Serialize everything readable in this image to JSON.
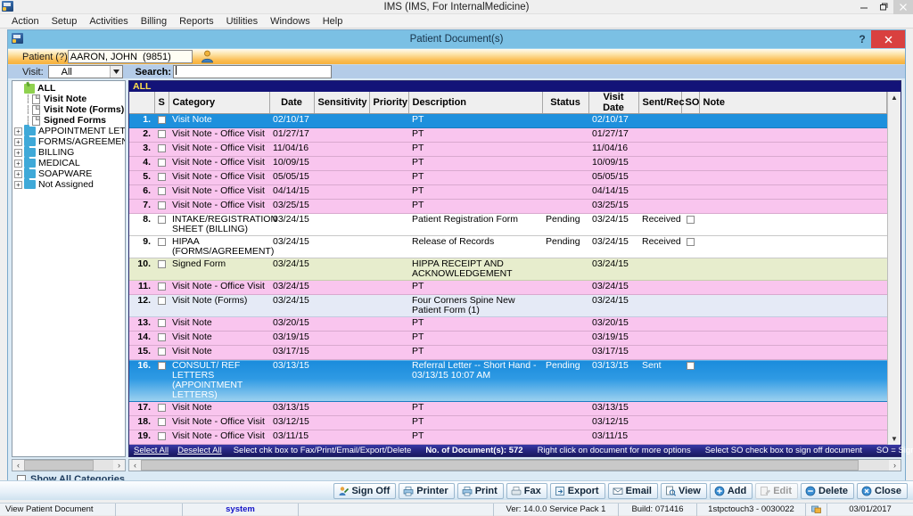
{
  "window": {
    "title": "IMS (IMS, For InternalMedicine)",
    "minimize": "–",
    "restore": "❐",
    "close": "✕"
  },
  "menubar": {
    "items": [
      "Action",
      "Setup",
      "Activities",
      "Billing",
      "Reports",
      "Utilities",
      "Windows",
      "Help"
    ]
  },
  "child_window": {
    "title": "Patient Document(s)",
    "help_label": "?",
    "close_label": "✕"
  },
  "patient_bar": {
    "label": "Patient (?)",
    "value": "AARON, JOHN  (9851)",
    "placeholder": ""
  },
  "search_bar": {
    "visit_label": "Visit:",
    "visit_value": "All",
    "search_label": "Search:",
    "search_value": "",
    "search_placeholder": ""
  },
  "tree": {
    "root": "ALL",
    "items": [
      {
        "label": "Visit Note",
        "icon": "document-icon",
        "bold": true,
        "expandable": false
      },
      {
        "label": "Visit Note (Forms)",
        "icon": "document-icon",
        "bold": true,
        "expandable": false
      },
      {
        "label": "Signed Forms",
        "icon": "document-icon",
        "bold": true,
        "expandable": false
      },
      {
        "label": "APPOINTMENT LETTER",
        "icon": "folder-icon",
        "bold": false,
        "expandable": true
      },
      {
        "label": "FORMS/AGREEMENT",
        "icon": "folder-icon",
        "bold": false,
        "expandable": true
      },
      {
        "label": "BILLING",
        "icon": "folder-icon",
        "bold": false,
        "expandable": true
      },
      {
        "label": "MEDICAL",
        "icon": "folder-icon",
        "bold": false,
        "expandable": true
      },
      {
        "label": "SOAPWARE",
        "icon": "folder-icon",
        "bold": false,
        "expandable": true
      },
      {
        "label": "Not Assigned",
        "icon": "folder-icon",
        "bold": false,
        "expandable": true
      }
    ]
  },
  "grid": {
    "tab_label": "ALL",
    "columns": [
      "",
      "S",
      "Category",
      "Date",
      "Sensitivity",
      "Priority",
      "Description",
      "Status",
      "Visit Date",
      "Sent/Rec",
      "SO",
      "Note"
    ],
    "rows": [
      {
        "n": "1.",
        "category": "Visit Note",
        "date": "02/10/17",
        "sensitivity": "",
        "priority": "",
        "description": "PT",
        "status": "",
        "visit_date": "02/10/17",
        "sent_rec": "",
        "so": "",
        "note": "",
        "style": "sel"
      },
      {
        "n": "2.",
        "category": "Visit Note - Office Visit",
        "date": "01/27/17",
        "sensitivity": "",
        "priority": "",
        "description": "PT",
        "status": "",
        "visit_date": "01/27/17",
        "sent_rec": "",
        "so": "",
        "note": "",
        "style": "pink"
      },
      {
        "n": "3.",
        "category": "Visit Note - Office Visit",
        "date": "11/04/16",
        "sensitivity": "",
        "priority": "",
        "description": "PT",
        "status": "",
        "visit_date": "11/04/16",
        "sent_rec": "",
        "so": "",
        "note": "",
        "style": "pink"
      },
      {
        "n": "4.",
        "category": "Visit Note - Office Visit",
        "date": "10/09/15",
        "sensitivity": "",
        "priority": "",
        "description": "PT",
        "status": "",
        "visit_date": "10/09/15",
        "sent_rec": "",
        "so": "",
        "note": "",
        "style": "pink"
      },
      {
        "n": "5.",
        "category": "Visit Note - Office Visit",
        "date": "05/05/15",
        "sensitivity": "",
        "priority": "",
        "description": "PT",
        "status": "",
        "visit_date": "05/05/15",
        "sent_rec": "",
        "so": "",
        "note": "",
        "style": "pink"
      },
      {
        "n": "6.",
        "category": "Visit Note - Office Visit",
        "date": "04/14/15",
        "sensitivity": "",
        "priority": "",
        "description": "PT",
        "status": "",
        "visit_date": "04/14/15",
        "sent_rec": "",
        "so": "",
        "note": "",
        "style": "pink"
      },
      {
        "n": "7.",
        "category": "Visit Note - Office Visit",
        "date": "03/25/15",
        "sensitivity": "",
        "priority": "",
        "description": "PT",
        "status": "",
        "visit_date": "03/25/15",
        "sent_rec": "",
        "so": "",
        "note": "",
        "style": "pink"
      },
      {
        "n": "8.",
        "category": "INTAKE/REGISTRATION SHEET (BILLING)",
        "date": "03/24/15",
        "sensitivity": "",
        "priority": "",
        "description": "Patient Registration Form",
        "status": "Pending",
        "visit_date": "03/24/15",
        "sent_rec": "Received",
        "so": "checkbox",
        "note": "",
        "style": "white"
      },
      {
        "n": "9.",
        "category": "HIPAA (FORMS/AGREEMENT)",
        "date": "03/24/15",
        "sensitivity": "",
        "priority": "",
        "description": "Release of Records",
        "status": "Pending",
        "visit_date": "03/24/15",
        "sent_rec": "Received",
        "so": "checkbox",
        "note": "",
        "style": "white"
      },
      {
        "n": "10.",
        "category": "Signed Form",
        "date": "03/24/15",
        "sensitivity": "",
        "priority": "",
        "description": "HIPPA RECEIPT AND ACKNOWLEDGEMENT",
        "status": "",
        "visit_date": "03/24/15",
        "sent_rec": "",
        "so": "",
        "note": "",
        "style": "green"
      },
      {
        "n": "11.",
        "category": "Visit Note - Office Visit",
        "date": "03/24/15",
        "sensitivity": "",
        "priority": "",
        "description": "PT",
        "status": "",
        "visit_date": "03/24/15",
        "sent_rec": "",
        "so": "",
        "note": "",
        "style": "pink"
      },
      {
        "n": "12.",
        "category": "Visit Note (Forms)",
        "date": "03/24/15",
        "sensitivity": "",
        "priority": "",
        "description": "Four Corners Spine New Patient Form (1)",
        "status": "",
        "visit_date": "03/24/15",
        "sent_rec": "",
        "so": "",
        "note": "",
        "style": "lav"
      },
      {
        "n": "13.",
        "category": "Visit Note",
        "date": "03/20/15",
        "sensitivity": "",
        "priority": "",
        "description": "PT",
        "status": "",
        "visit_date": "03/20/15",
        "sent_rec": "",
        "so": "",
        "note": "",
        "style": "pink"
      },
      {
        "n": "14.",
        "category": "Visit Note",
        "date": "03/19/15",
        "sensitivity": "",
        "priority": "",
        "description": "PT",
        "status": "",
        "visit_date": "03/19/15",
        "sent_rec": "",
        "so": "",
        "note": "",
        "style": "pink"
      },
      {
        "n": "15.",
        "category": "Visit Note",
        "date": "03/17/15",
        "sensitivity": "",
        "priority": "",
        "description": "PT",
        "status": "",
        "visit_date": "03/17/15",
        "sent_rec": "",
        "so": "",
        "note": "",
        "style": "pink"
      },
      {
        "n": "16.",
        "category": "CONSULT/ REF LETTERS (APPOINTMENT LETTERS)",
        "date": "03/13/15",
        "sensitivity": "",
        "priority": "",
        "description": "Referral Letter -- Short Hand - 03/13/15 10:07 AM",
        "status": "Pending",
        "visit_date": "03/13/15",
        "sent_rec": "Sent",
        "so": "checkbox",
        "note": "",
        "style": "selgrad"
      },
      {
        "n": "17.",
        "category": "Visit Note",
        "date": "03/13/15",
        "sensitivity": "",
        "priority": "",
        "description": "PT",
        "status": "",
        "visit_date": "03/13/15",
        "sent_rec": "",
        "so": "",
        "note": "",
        "style": "pink"
      },
      {
        "n": "18.",
        "category": "Visit Note - Office Visit",
        "date": "03/12/15",
        "sensitivity": "",
        "priority": "",
        "description": "PT",
        "status": "",
        "visit_date": "03/12/15",
        "sent_rec": "",
        "so": "",
        "note": "",
        "style": "pink"
      },
      {
        "n": "19.",
        "category": "Visit Note - Office Visit",
        "date": "03/11/15",
        "sensitivity": "",
        "priority": "",
        "description": "PT",
        "status": "",
        "visit_date": "03/11/15",
        "sent_rec": "",
        "so": "",
        "note": "",
        "style": "pink"
      }
    ],
    "status_strip": {
      "select_all": "Select All",
      "deselect_all": "Deselect All",
      "hint1": "Select chk box to Fax/Print/Email/Export/Delete",
      "count": "No. of Document(s): 572",
      "hint2": "Right click on document for more options",
      "hint3": "Select SO check box to sign off document",
      "hint4": "SO = Sign Off"
    }
  },
  "show_all_categories": {
    "label": "Show All Categories",
    "checked": false
  },
  "toolbar": {
    "buttons": [
      {
        "label": "Sign Off",
        "icon": "signoff-icon",
        "disabled": false
      },
      {
        "label": "Printer",
        "icon": "printer-icon",
        "disabled": false
      },
      {
        "label": "Print",
        "icon": "print-icon",
        "disabled": false
      },
      {
        "label": "Fax",
        "icon": "fax-icon",
        "disabled": false
      },
      {
        "label": "Export",
        "icon": "export-icon",
        "disabled": false
      },
      {
        "label": "Email",
        "icon": "email-icon",
        "disabled": false
      },
      {
        "label": "View",
        "icon": "view-icon",
        "disabled": false
      },
      {
        "label": "Add",
        "icon": "add-icon",
        "disabled": false
      },
      {
        "label": "Edit",
        "icon": "edit-icon",
        "disabled": true
      },
      {
        "label": "Delete",
        "icon": "delete-icon",
        "disabled": false
      },
      {
        "label": "Close",
        "icon": "close-icon",
        "disabled": false
      }
    ]
  },
  "statusbar": {
    "mode": "View Patient Document",
    "blank1": "",
    "user": "system",
    "blank2": "",
    "version": "Ver: 14.0.0 Service Pack 1",
    "build": "Build: 071416",
    "machine": "1stpctouch3 - 0030022",
    "date": "03/01/2017"
  }
}
